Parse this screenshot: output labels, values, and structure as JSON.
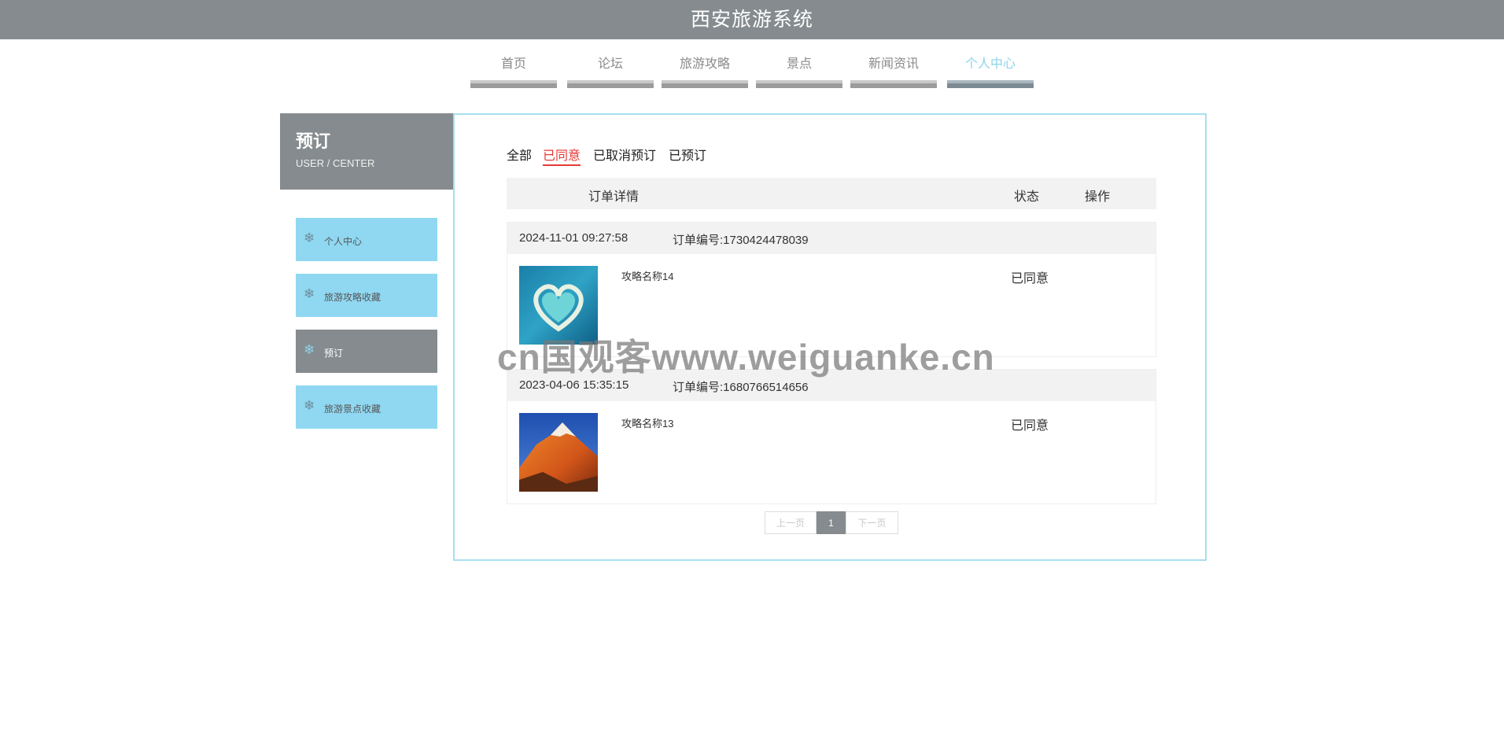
{
  "app_title": "西安旅游系统",
  "nav": [
    {
      "label": "首页",
      "active": false
    },
    {
      "label": "论坛",
      "active": false
    },
    {
      "label": "旅游攻略",
      "active": false
    },
    {
      "label": "景点",
      "active": false
    },
    {
      "label": "新闻资讯",
      "active": false
    },
    {
      "label": "个人中心",
      "active": true
    }
  ],
  "sidebar": {
    "title": "预订",
    "subtitle": "USER / CENTER",
    "items": [
      {
        "label": "个人中心",
        "icon": "snowflake-icon",
        "active": false
      },
      {
        "label": "旅游攻略收藏",
        "icon": "snowflake-icon",
        "active": false
      },
      {
        "label": "预订",
        "icon": "snowflake-icon",
        "active": true
      },
      {
        "label": "旅游景点收藏",
        "icon": "snowflake-icon",
        "active": false
      }
    ]
  },
  "tabs": [
    {
      "label": "全部",
      "active": false
    },
    {
      "label": "已同意",
      "active": true
    },
    {
      "label": "已取消预订",
      "active": false
    },
    {
      "label": "已预订",
      "active": false
    }
  ],
  "table_header": {
    "detail": "订单详情",
    "status": "状态",
    "action": "操作"
  },
  "orders": [
    {
      "time": "2024-11-01 09:27:58",
      "order_no": "订单编号:1730424478039",
      "name": "攻略名称14",
      "status": "已同意",
      "thumb": "heart-island-image"
    },
    {
      "time": "2023-04-06 15:35:15",
      "order_no": "订单编号:1680766514656",
      "name": "攻略名称13",
      "status": "已同意",
      "thumb": "mountain-image"
    }
  ],
  "pager": {
    "prev": "上一页",
    "current": "1",
    "next": "下一页"
  },
  "watermark": "cn国观客www.weiguanke.cn",
  "colors": {
    "header_bg": "#858b8e",
    "sidebar_item_bg": "#90d8f2",
    "active_tab": "#e53935",
    "nav_active": "#8dd4ea"
  }
}
